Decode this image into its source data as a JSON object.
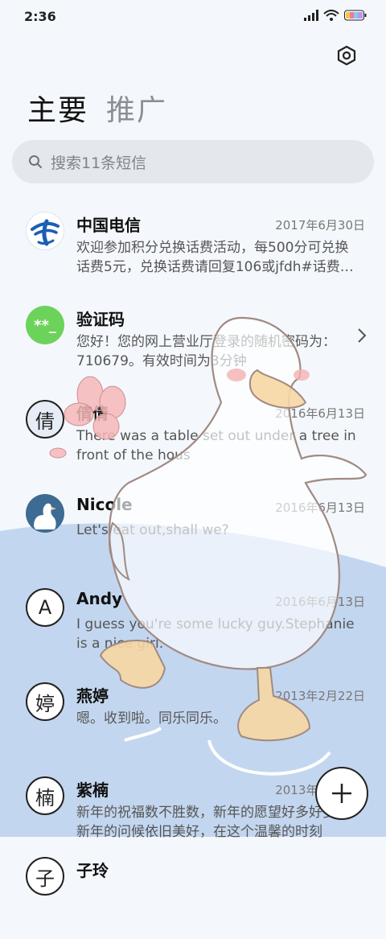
{
  "status": {
    "time": "2:36"
  },
  "tabs": [
    {
      "label": "主要"
    },
    {
      "label": "推广"
    }
  ],
  "search": {
    "placeholder": "搜索11条短信"
  },
  "messages": [
    {
      "name": "中国电信",
      "date": "2017年6月30日",
      "preview": "欢迎参加积分兑换话费活动，每500分可兑换话费5元，兑换话费请回复106或jfdh#话费…",
      "avatar": "telecom-logo"
    },
    {
      "name": "验证码",
      "date": "",
      "preview": "您好！您的网上营业厅登录的随机密码为：710679。有效时间为3分钟",
      "avatar_text": "**_"
    },
    {
      "name": "倩倩",
      "date": "2016年6月13日",
      "preview": "There was a table set out under a tree in front of the hous",
      "avatar_text": "倩"
    },
    {
      "name": "Nicole",
      "date": "2016年6月13日",
      "preview": "Let's eat out,shall we?",
      "avatar": "duck-photo"
    },
    {
      "name": "Andy",
      "date": "2016年6月13日",
      "preview": "I guess you're some lucky guy.Stephanie is a nice girl.",
      "avatar_text": "A"
    },
    {
      "name": "燕婷",
      "date": "2013年2月22日",
      "preview": "嗯。收到啦。同乐同乐。",
      "avatar_text": "婷"
    },
    {
      "name": "紫楠",
      "date": "2013年2月22日",
      "preview": "新年的祝福数不胜数，新年的愿望好多好多，新年的问候依旧美好，在这个温馨的时刻",
      "avatar_text": "楠"
    },
    {
      "name": "子玲",
      "date": "",
      "preview": "",
      "avatar_text": "子"
    }
  ],
  "colors": {
    "accent_green": "#6cd35a",
    "telecom_blue": "#1a5fb4",
    "wave_blue": "#c3d6ef"
  }
}
